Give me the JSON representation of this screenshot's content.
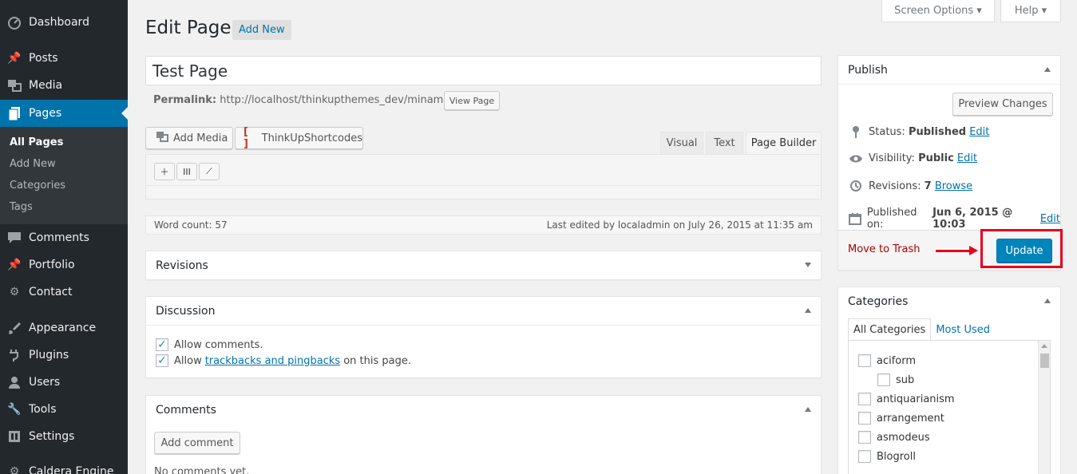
{
  "sidebar": {
    "items": [
      {
        "label": "Dashboard",
        "icon": "dashboard-icon"
      },
      {
        "label": "Posts",
        "icon": "pin-icon"
      },
      {
        "label": "Media",
        "icon": "media-icon"
      },
      {
        "label": "Pages",
        "icon": "pages-icon"
      },
      {
        "label": "Comments",
        "icon": "comment-icon"
      },
      {
        "label": "Portfolio",
        "icon": "pin-icon"
      },
      {
        "label": "Contact",
        "icon": "gear-icon"
      },
      {
        "label": "Appearance",
        "icon": "brush-icon"
      },
      {
        "label": "Plugins",
        "icon": "plugin-icon"
      },
      {
        "label": "Users",
        "icon": "user-icon"
      },
      {
        "label": "Tools",
        "icon": "wrench-icon"
      },
      {
        "label": "Settings",
        "icon": "settings-icon"
      },
      {
        "label": "Caldera Engine",
        "icon": "engine-icon"
      }
    ],
    "submenu": [
      "All Pages",
      "Add New",
      "Categories",
      "Tags"
    ]
  },
  "top": {
    "screen_options": "Screen Options ▾",
    "help": "Help ▾"
  },
  "header": {
    "title": "Edit Page",
    "add_new": "Add New"
  },
  "post": {
    "title": "Test Page",
    "permalink_label": "Permalink:",
    "permalink_url": "http://localhost/thinkupthemes_dev/minamaze/",
    "view_page": "View Page"
  },
  "editor": {
    "add_media": "Add Media",
    "shortcodes": "ThinkUpShortcodes",
    "tabs": [
      "Visual",
      "Text",
      "Page Builder"
    ],
    "word_count": "Word count: 57",
    "last_edited": "Last edited by localadmin on July 26, 2015 at 11:35 am"
  },
  "revisions_box": {
    "title": "Revisions"
  },
  "discussion": {
    "title": "Discussion",
    "allow_comments": "Allow comments.",
    "allow_prefix": "Allow",
    "trackbacks_link": "trackbacks and pingbacks",
    "allow_suffix": "on this page."
  },
  "comments_box": {
    "title": "Comments",
    "add_comment": "Add comment",
    "empty": "No comments yet."
  },
  "publish": {
    "title": "Publish",
    "preview": "Preview Changes",
    "status_label": "Status:",
    "status_value": "Published",
    "visibility_label": "Visibility:",
    "visibility_value": "Public",
    "revisions_label": "Revisions:",
    "revisions_value": "7",
    "browse": "Browse",
    "published_label": "Published on:",
    "published_value": "Jun 6, 2015 @ 10:03",
    "edit": "Edit",
    "trash": "Move to Trash",
    "update": "Update"
  },
  "categories": {
    "title": "Categories",
    "tabs": [
      "All Categories",
      "Most Used"
    ],
    "items": [
      "aciform",
      "sub",
      "antiquarianism",
      "arrangement",
      "asmodeus",
      "Blogroll"
    ]
  },
  "colors": {
    "accent": "#0073aa",
    "sidebar": "#23282d",
    "highlight": "#e8001c"
  }
}
